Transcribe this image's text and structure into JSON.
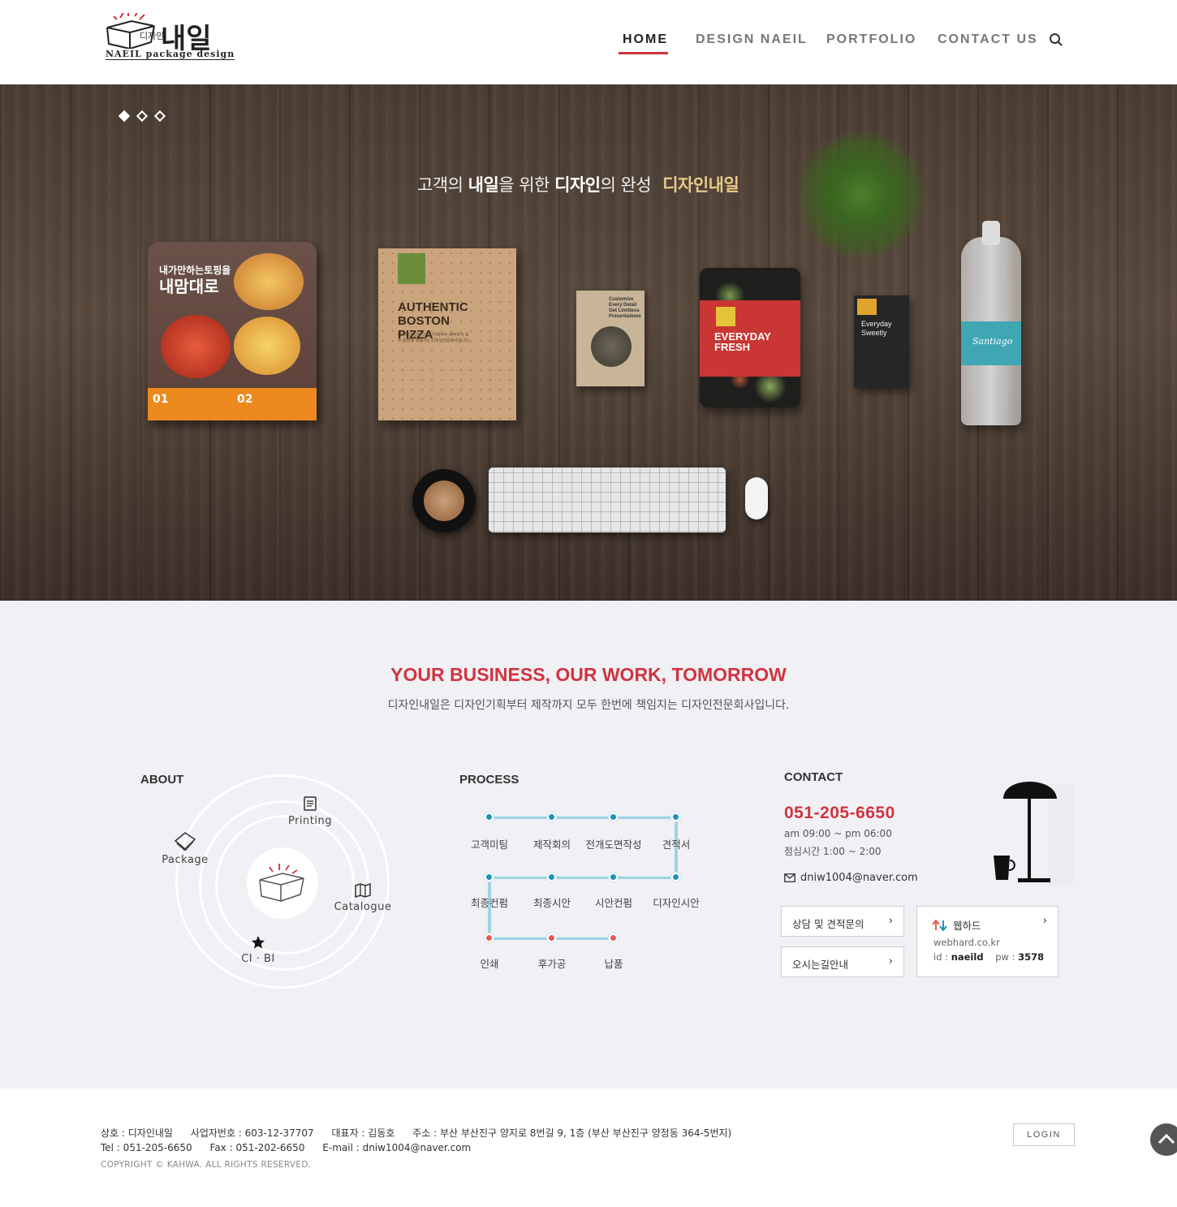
{
  "header": {
    "logo_ko": "내일",
    "logo_small": "디자인",
    "logo_en": "NAEIL package design",
    "nav": [
      {
        "label": "HOME",
        "active": true
      },
      {
        "label": "DESIGN NAEIL",
        "active": false
      },
      {
        "label": "PORTFOLIO",
        "active": false
      },
      {
        "label": "CONTACT US",
        "active": false
      }
    ],
    "search_icon": "search-icon",
    "accent_color": "#d0343f"
  },
  "hero": {
    "slides": 3,
    "active_slide": 1,
    "title_parts": {
      "a": "고객의 ",
      "b": "내일",
      "c": "을 위한 ",
      "d": "디자인",
      "e": "의 완성",
      "brand": "디자인내일"
    },
    "products": {
      "pizza_heading_1": "내가만하는토핑을",
      "pizza_heading_2": "내맘대로",
      "pizza_strip_1": "01",
      "pizza_strip_2": "02",
      "kraft_title": "AUTHENTIC BOSTON PIZZA",
      "seed_text": "Customize Every Detail Get Limitless Presentations",
      "salad_text": "EVERYDAY FRESH",
      "choco_text": "Everyday Sweetly",
      "bottle_text": "Santiago"
    }
  },
  "intro": {
    "tagline": "YOUR BUSINESS, OUR WORK, TOMORROW",
    "subline": "디자인내일은 디자인기획부터 제작까지 모두 한번에 책임지는 디자인전문회사입니다."
  },
  "about": {
    "title": "ABOUT",
    "items": {
      "printing": "Printing",
      "package": "Package",
      "catalogue": "Catalogue",
      "cibi": "CI · BI"
    }
  },
  "process": {
    "title": "PROCESS",
    "row1": [
      "고객미팅",
      "제작회의",
      "전개도면작성",
      "견적서"
    ],
    "row2": [
      "최종컨펌",
      "최종시안",
      "시안컨펌",
      "디자인시안"
    ],
    "row3": [
      "인쇄",
      "후가공",
      "납품"
    ],
    "colors": {
      "blue": "#1e93b8",
      "red": "#e25b54",
      "line": "#9fd3e0"
    }
  },
  "contact": {
    "title": "CONTACT",
    "phone": "051-205-6650",
    "hours": "am 09:00 ~ pm 06:00",
    "lunch": "점심시간  1:00 ~ 2:00",
    "email": "dniw1004@naver.com",
    "inquiry_label": "상담 및 견적문의",
    "directions_label": "오시는길안내",
    "webhard": {
      "label": "웹하드",
      "url": "webhard.co.kr",
      "id_label": "id : ",
      "id_value": "naeild",
      "pw_label": "pw : ",
      "pw_value": "3578"
    }
  },
  "footer": {
    "company": "상호 : 디자인내일",
    "biz_no": "사업자번호 : 603-12-37707",
    "ceo": "대표자 : 김동호",
    "address": "주소 : 부산 부산진구 양지로 8번길 9, 1층 (부산 부산진구 양정동 364-5번지)",
    "tel": "Tel : 051-205-6650",
    "fax": "Fax : 051-202-6650",
    "email": "E-mail : dniw1004@naver.com",
    "copyright": "COPYRIGHT © KAHWA. ALL RIGHTS RESERVED.",
    "login_label": "LOGIN"
  }
}
